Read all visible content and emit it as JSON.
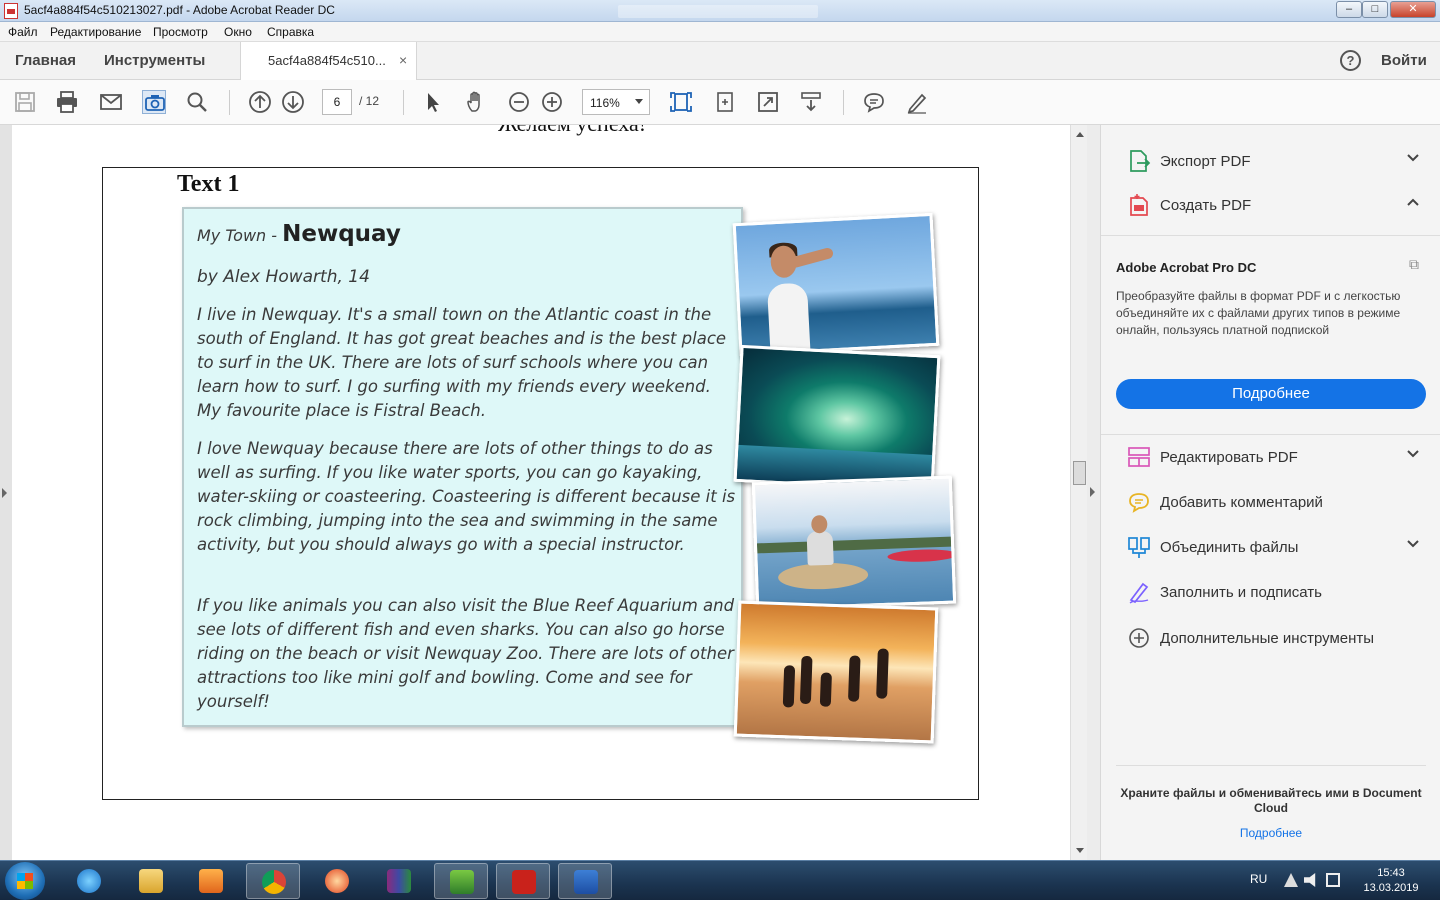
{
  "window": {
    "title": "5acf4a884f54c510213027.pdf - Adobe Acrobat Reader DC",
    "min": "–",
    "max": "□",
    "close": "✕"
  },
  "menu": [
    "Файл",
    "Редактирование",
    "Просмотр",
    "Окно",
    "Справка"
  ],
  "tabs": {
    "home": "Главная",
    "tools": "Инструменты",
    "document": "5acf4a884f54c510...",
    "close": "×",
    "help": "?",
    "signin": "Войти"
  },
  "toolbar": {
    "page_current": "6",
    "page_total": "/ 12",
    "zoom": "116%"
  },
  "document": {
    "top_cut_text": "Желаем успеха!",
    "section_title": "Text 1",
    "heading_prefix": "My Town - ",
    "heading_main": "Newquay",
    "byline": "by Alex Howarth, 14",
    "para1": "I live in Newquay. It's a small town on the Atlantic coast in the south of England. It has got great beaches and is the best place to surf in the UK. There are lots of surf schools where you can learn how to surf. I go surfing with my friends every weekend. My favourite place is Fistral Beach.",
    "para2": "I love Newquay because there are lots of other things to do as well as surfing. If you like water sports, you can go kayaking, water-skiing or coasteering. Coasteering is different because it is rock climbing, jumping into the sea and swimming in the same activity, but you should always go with a special instructor.",
    "para3": "If you like animals you can also visit the Blue Reef Aquarium and see lots of different fish and even sharks. You can also go horse riding on the beach or visit Newquay Zoo. There are lots of other attractions too like mini golf and bowling. Come and see for yourself!"
  },
  "right_panel": {
    "export_pdf": "Экспорт PDF",
    "create_pdf": "Создать PDF",
    "promo_title": "Adobe Acrobat Pro DC",
    "promo_desc": "Преобразуйте файлы в формат PDF и с легкостью объединяйте их с файлами других типов в режиме онлайн, пользуясь платной подпиской",
    "promo_button": "Подробнее",
    "edit_pdf": "Редактировать PDF",
    "comment": "Добавить комментарий",
    "combine": "Объединить файлы",
    "fill_sign": "Заполнить и подписать",
    "more_tools": "Дополнительные инструменты",
    "cloud_text": "Храните файлы и обменивайтесь ими в Document Cloud",
    "cloud_link": "Подробнее"
  },
  "taskbar": {
    "lang": "RU",
    "time": "15:43",
    "date": "13.03.2019"
  },
  "colors": {
    "accent": "#1473e6",
    "card_bg": "#def8f8"
  }
}
